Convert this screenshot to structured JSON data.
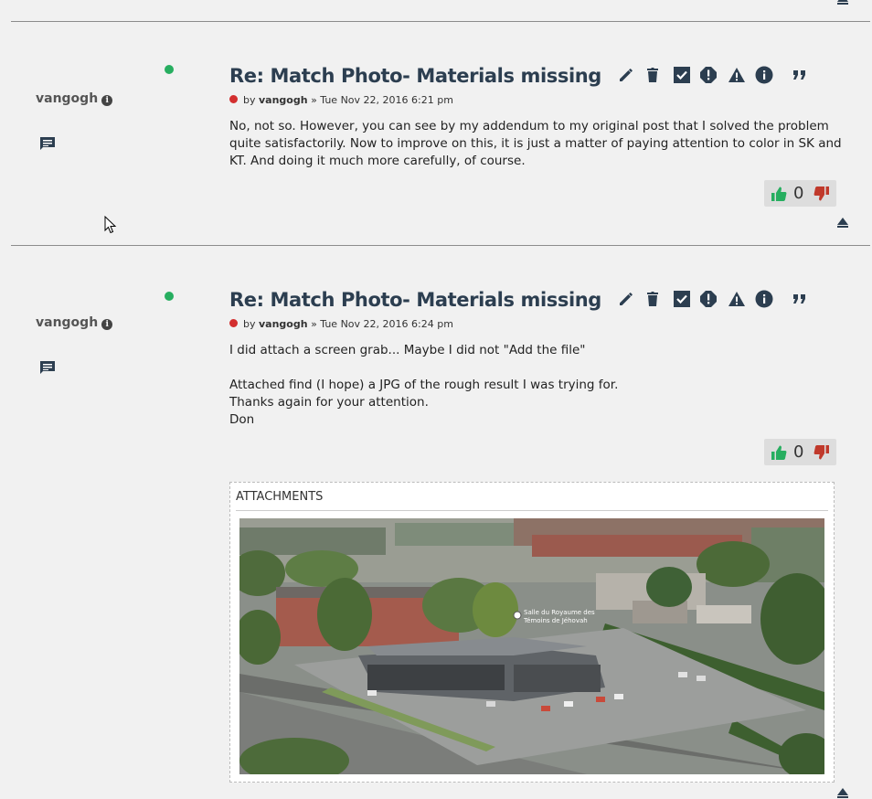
{
  "posts": [
    {
      "author": "vangogh",
      "title": "Re: Match Photo- Materials missing",
      "by": "by",
      "meta_user": "vangogh",
      "meta_date": "» Tue Nov 22, 2016 6:21 pm",
      "paragraphs": [
        "No, not so. However, you can see by my addendum to my original post that I solved the problem quite satisfactorily. Now to improve on this, it is just a matter of paying attention to color in SK and KT. And doing it much more carefully, of course."
      ],
      "vote_count": "0"
    },
    {
      "author": "vangogh",
      "title": "Re: Match Photo- Materials missing",
      "by": "by",
      "meta_user": "vangogh",
      "meta_date": "» Tue Nov 22, 2016 6:24 pm",
      "paragraphs": [
        "I did attach a screen grab... Maybe I did not \"Add the file\"",
        "",
        "Attached find (I hope) a JPG of the rough result I was trying for.",
        "Thanks again for your attention.",
        "Don"
      ],
      "vote_count": "0",
      "attachments_label": "ATTACHMENTS",
      "image_label_1": "Salle du Royaume des",
      "image_label_2": "Témoins de Jéhovah"
    }
  ],
  "icons": {
    "actions": [
      "edit-icon",
      "delete-icon",
      "approve-icon",
      "warn-icon",
      "report-icon",
      "info-icon",
      "quote-icon"
    ],
    "vote_up": "thumbs-up-icon",
    "vote_down": "thumbs-down-icon",
    "pm": "message-icon",
    "top": "back-to-top-icon"
  },
  "colors": {
    "background": "#f1f1f1",
    "title": "#2c3e50",
    "online": "#27ae60",
    "unread": "#d32f2f",
    "vote_up": "#27ae60",
    "vote_down": "#c0392b"
  }
}
